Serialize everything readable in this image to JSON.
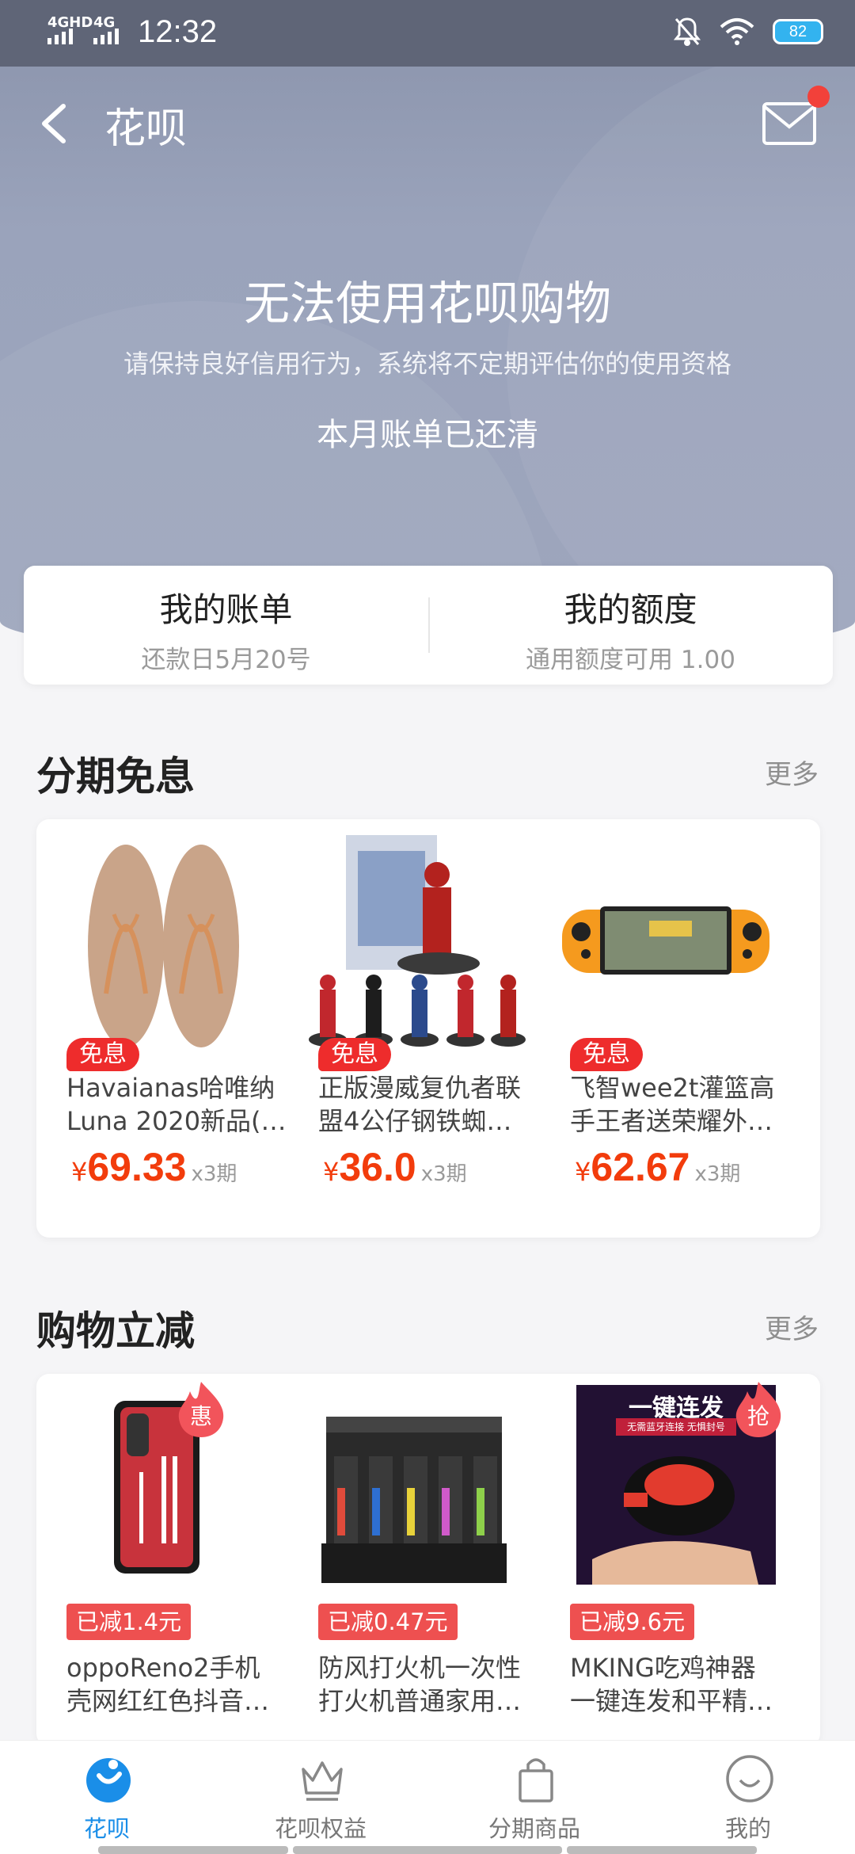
{
  "status": {
    "net1": "4GHD",
    "net2": "4G",
    "time": "12:32",
    "battery": "82"
  },
  "nav": {
    "title": "花呗"
  },
  "hero": {
    "title": "无法使用花呗购物",
    "subtitle": "请保持良好信用行为，系统将不定期评估你的使用资格",
    "paid": "本月账单已还清"
  },
  "account": {
    "bill_title": "我的账单",
    "bill_sub": "还款日5月20号",
    "limit_title": "我的额度",
    "limit_sub": "通用额度可用 1.00"
  },
  "installment": {
    "title": "分期免息",
    "more": "更多",
    "items": [
      {
        "badge": "免息",
        "line1": "Havaianas哈唯纳",
        "line2": "Luna 2020新品(…",
        "currency": "¥",
        "price": "69.33",
        "inst": "x3期"
      },
      {
        "badge": "免息",
        "line1": "正版漫威复仇者联",
        "line2": "盟4公仔钢铁蜘…",
        "currency": "¥",
        "price": "36.0",
        "inst": "x3期"
      },
      {
        "badge": "免息",
        "line1": "飞智wee2t灌篮高",
        "line2": "手王者送荣耀外…",
        "currency": "¥",
        "price": "62.67",
        "inst": "x3期"
      }
    ]
  },
  "discount": {
    "title": "购物立减",
    "more": "更多",
    "items": [
      {
        "tag": "惠",
        "reduce": "已减1.4元",
        "line1": "oppoReno2手机",
        "line2": "壳网红红色抖音…"
      },
      {
        "reduce": "已减0.47元",
        "line1": "防风打火机一次性",
        "line2": "打火机普通家用…"
      },
      {
        "tag": "抢",
        "reduce": "已减9.6元",
        "line1": "MKING吃鸡神器",
        "line2": "一键连发和平精…",
        "img_title": "一键连发",
        "img_sub": "无需蓝牙连接 无惧封号"
      }
    ]
  },
  "tabs": [
    {
      "label": "花呗"
    },
    {
      "label": "花呗权益"
    },
    {
      "label": "分期商品"
    },
    {
      "label": "我的"
    }
  ],
  "colors": {
    "accent": "#1a8ee8",
    "price": "#f23c0c",
    "badge": "#ee2c2c",
    "hero": "#9aa3bb"
  }
}
